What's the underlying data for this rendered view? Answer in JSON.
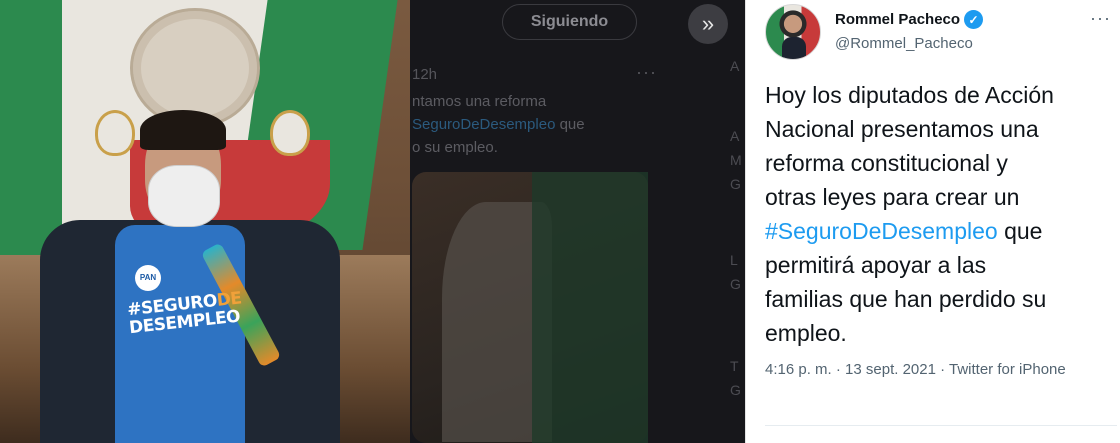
{
  "background_timeline": {
    "follow_button_label": "Siguiendo",
    "expand_label": "»",
    "time": "12h",
    "more_label": "···",
    "text_before": "ntamos una reforma\n",
    "hashtag": "SeguroDeDesempleo",
    "text_after": " que\no su empleo.",
    "side_letters": [
      "A",
      "A",
      "M",
      "G",
      "L",
      "G",
      "T",
      "G"
    ]
  },
  "photo": {
    "shirt_logo": "PAN",
    "shirt_text_line1": "#SEGURO",
    "shirt_text_line1_highlight": "DE",
    "shirt_text_line2": "DESEMPLEO"
  },
  "tweet": {
    "author_name": "Rommel Pacheco",
    "verified_symbol": "✓",
    "handle": "@Rommel_Pacheco",
    "more_label": "···",
    "text_before": "Hoy los diputados de Acción\nNacional presentamos una\nreforma constitucional y\notras leyes para crear un\n",
    "hashtag": "#SeguroDeDesempleo",
    "text_after": " que\npermitirá apoyar a las\nfamilias que han perdido su\nempleo.",
    "meta": "4:16 p. m. · 13 sept. 2021 · Twitter for iPhone"
  },
  "colors": {
    "link": "#1d9bf0",
    "verified": "#1d9bf0",
    "text": "#0f1419",
    "secondary": "#536471"
  }
}
